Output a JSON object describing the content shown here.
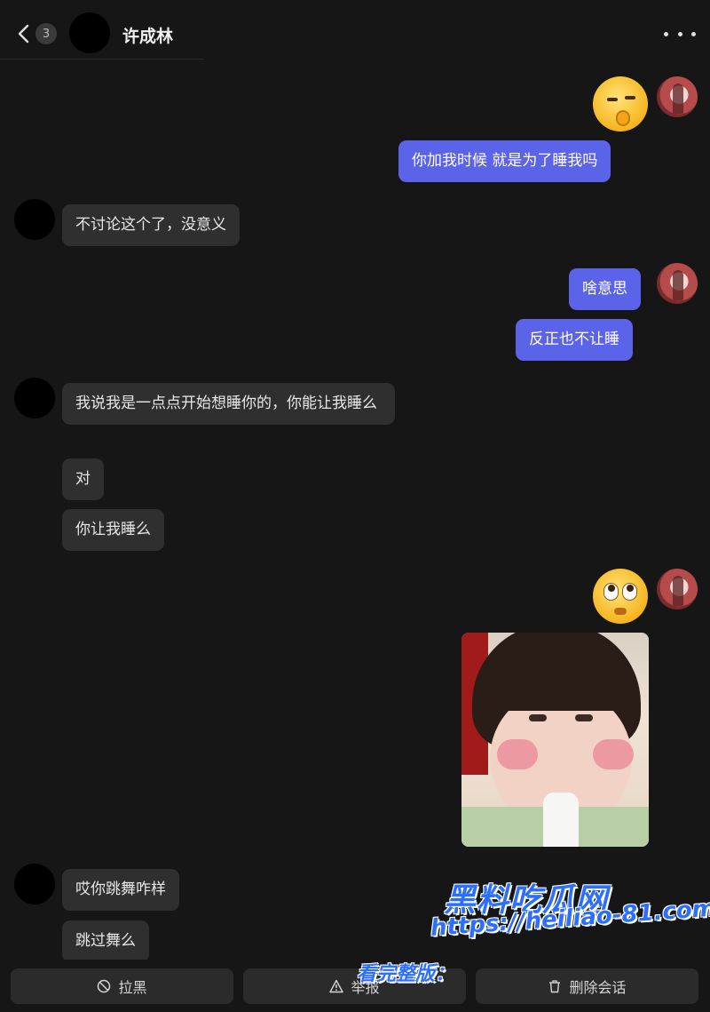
{
  "header": {
    "back_count": "3",
    "contact_name": "许成林"
  },
  "messages": {
    "out_1": "你加我时候  就是为了睡我吗",
    "in_1": "不讨论这个了，没意义",
    "out_2": "啥意思",
    "out_3": "反正也不让睡",
    "in_2": "我说我是一点点开始想睡你的，你能让我睡么",
    "in_3": "对",
    "in_4": "你让我睡么",
    "in_5": "哎你跳舞咋样",
    "in_6": "跳过舞么"
  },
  "emojis": {
    "sticker_1": "shush-face-emoji",
    "sticker_2": "eye-roll-face-emoji"
  },
  "actions": {
    "block_label": "拉黑",
    "report_label": "举报",
    "delete_label": "删除会话"
  },
  "watermark": {
    "title": "黑料吃瓜网",
    "url": "https://heiliao-81.com",
    "prefix": "看完整版："
  },
  "colors": {
    "background": "#161616",
    "incoming_bubble": "#2f2f2f",
    "outgoing_bubble": "#5b63e8",
    "watermark_blue": "#2c6fff"
  }
}
